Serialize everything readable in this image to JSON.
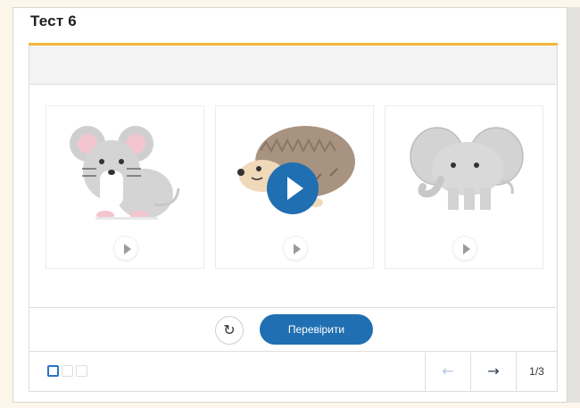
{
  "title": "Тест 6",
  "tiles": [
    {
      "animal": "mouse",
      "play_icon": "play-icon"
    },
    {
      "animal": "hedgehog",
      "play_icon": "play-icon"
    },
    {
      "animal": "elephant",
      "play_icon": "play-icon"
    }
  ],
  "controls": {
    "reset_icon": "↻",
    "check_label": "Перевірити"
  },
  "progress": {
    "total": 3,
    "current": 1
  },
  "nav": {
    "prev_icon": "←",
    "next_icon": "→",
    "counter": "1/3"
  },
  "colors": {
    "accent": "#f2b63a",
    "primary": "#1f6fb2",
    "background": "#fdf6ea"
  }
}
